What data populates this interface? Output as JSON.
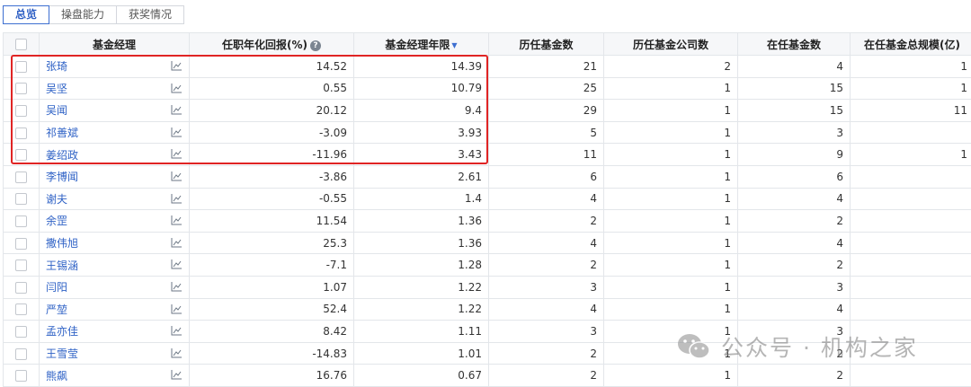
{
  "tabs": [
    {
      "label": "总览",
      "active": true
    },
    {
      "label": "操盘能力",
      "active": false
    },
    {
      "label": "获奖情况",
      "active": false
    }
  ],
  "table": {
    "headers": {
      "manager": "基金经理",
      "annual_return": "任职年化回报(%)",
      "years": "基金经理年限",
      "hist_funds": "历任基金数",
      "hist_companies": "历任基金公司数",
      "current_funds": "在任基金数",
      "total_scale": "在任基金总规模(亿)"
    },
    "help_glyph": "?",
    "sort_glyph": "▼",
    "rows": [
      {
        "name": "张琦",
        "annual_return": "14.52",
        "years": "14.39",
        "hist_funds": "21",
        "hist_companies": "2",
        "current_funds": "4",
        "total_scale": "1"
      },
      {
        "name": "吴坚",
        "annual_return": "0.55",
        "years": "10.79",
        "hist_funds": "25",
        "hist_companies": "1",
        "current_funds": "15",
        "total_scale": "1"
      },
      {
        "name": "吴闻",
        "annual_return": "20.12",
        "years": "9.4",
        "hist_funds": "29",
        "hist_companies": "1",
        "current_funds": "15",
        "total_scale": "11"
      },
      {
        "name": "祁善斌",
        "annual_return": "-3.09",
        "years": "3.93",
        "hist_funds": "5",
        "hist_companies": "1",
        "current_funds": "3",
        "total_scale": ""
      },
      {
        "name": "姜绍政",
        "annual_return": "-11.96",
        "years": "3.43",
        "hist_funds": "11",
        "hist_companies": "1",
        "current_funds": "9",
        "total_scale": "1"
      },
      {
        "name": "李博闻",
        "annual_return": "-3.86",
        "years": "2.61",
        "hist_funds": "6",
        "hist_companies": "1",
        "current_funds": "6",
        "total_scale": ""
      },
      {
        "name": "谢夫",
        "annual_return": "-0.55",
        "years": "1.4",
        "hist_funds": "4",
        "hist_companies": "1",
        "current_funds": "4",
        "total_scale": ""
      },
      {
        "name": "余罡",
        "annual_return": "11.54",
        "years": "1.36",
        "hist_funds": "2",
        "hist_companies": "1",
        "current_funds": "2",
        "total_scale": ""
      },
      {
        "name": "撒伟旭",
        "annual_return": "25.3",
        "years": "1.36",
        "hist_funds": "4",
        "hist_companies": "1",
        "current_funds": "4",
        "total_scale": ""
      },
      {
        "name": "王锡涵",
        "annual_return": "-7.1",
        "years": "1.28",
        "hist_funds": "2",
        "hist_companies": "1",
        "current_funds": "2",
        "total_scale": ""
      },
      {
        "name": "闫阳",
        "annual_return": "1.07",
        "years": "1.22",
        "hist_funds": "3",
        "hist_companies": "1",
        "current_funds": "3",
        "total_scale": ""
      },
      {
        "name": "严堃",
        "annual_return": "52.4",
        "years": "1.22",
        "hist_funds": "4",
        "hist_companies": "1",
        "current_funds": "4",
        "total_scale": ""
      },
      {
        "name": "孟亦佳",
        "annual_return": "8.42",
        "years": "1.11",
        "hist_funds": "3",
        "hist_companies": "1",
        "current_funds": "3",
        "total_scale": ""
      },
      {
        "name": "王雪莹",
        "annual_return": "-14.83",
        "years": "1.01",
        "hist_funds": "2",
        "hist_companies": "1",
        "current_funds": "2",
        "total_scale": ""
      },
      {
        "name": "熊飙",
        "annual_return": "16.76",
        "years": "0.67",
        "hist_funds": "2",
        "hist_companies": "1",
        "current_funds": "2",
        "total_scale": ""
      }
    ]
  },
  "watermark": {
    "text": "公众号 · 机构之家"
  },
  "colors": {
    "accent": "#3d6fd1",
    "link": "#2f62c6",
    "highlight": "#e02424"
  }
}
